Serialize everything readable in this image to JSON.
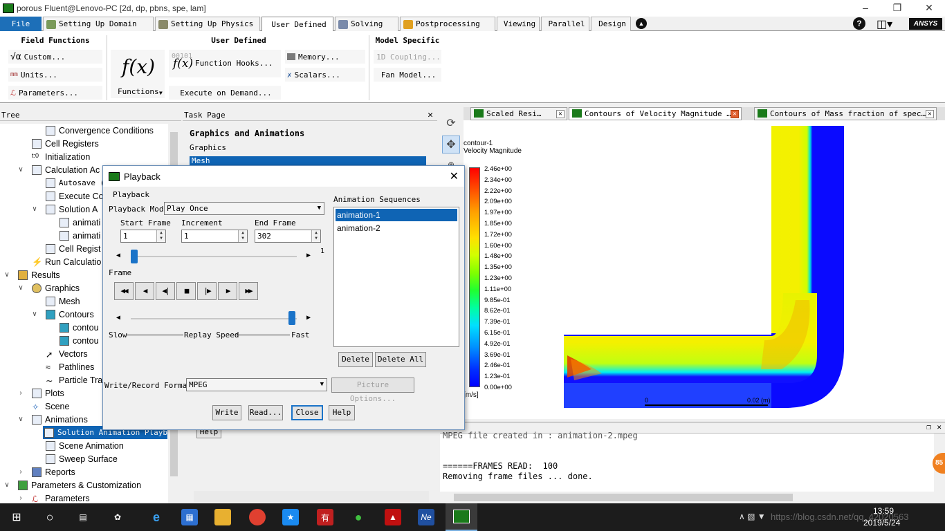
{
  "window": {
    "title": "porous Fluent@Lenovo-PC  [2d, dp, pbns, spe, lam]"
  },
  "tabs": [
    {
      "label": "File"
    },
    {
      "label": "Setting Up Domain"
    },
    {
      "label": "Setting Up Physics"
    },
    {
      "label": "User Defined"
    },
    {
      "label": "Solving"
    },
    {
      "label": "Postprocessing"
    },
    {
      "label": "Viewing"
    },
    {
      "label": "Parallel"
    },
    {
      "label": "Design"
    }
  ],
  "brand": "ANSYS",
  "ribbon": {
    "field_functions": {
      "title": "Field Functions",
      "custom": "Custom...",
      "units": "Units...",
      "parameters": "Parameters..."
    },
    "user_defined": {
      "title": "User Defined",
      "functions": "Functions",
      "function_hooks": "Function Hooks...",
      "execute_on_demand": "Execute on Demand...",
      "memory": "Memory...",
      "scalars": "Scalars...",
      "hooks_bits": "00101"
    },
    "model_specific": {
      "title": "Model Specific",
      "coupling": "1D Coupling...",
      "fan_model": "Fan Model..."
    }
  },
  "tree": {
    "header": "Tree",
    "items": [
      {
        "label": "Convergence Conditions"
      },
      {
        "label": "Cell Registers"
      },
      {
        "label": "Initialization"
      },
      {
        "label": "Calculation Ac"
      },
      {
        "label": "Autosave (Every 1 iter"
      },
      {
        "label": "Execute Co"
      },
      {
        "label": "Solution A"
      },
      {
        "label": "animati"
      },
      {
        "label": "animati"
      },
      {
        "label": "Cell Regist"
      },
      {
        "label": "Run Calculatio"
      },
      {
        "label": "Results"
      },
      {
        "label": "Graphics"
      },
      {
        "label": "Mesh"
      },
      {
        "label": "Contours"
      },
      {
        "label": "contou"
      },
      {
        "label": "contou"
      },
      {
        "label": "Vectors"
      },
      {
        "label": "Pathlines"
      },
      {
        "label": "Particle Tra"
      },
      {
        "label": "Plots"
      },
      {
        "label": "Scene"
      },
      {
        "label": "Animations"
      },
      {
        "label": "Solution Animation Playback"
      },
      {
        "label": "Scene Animation"
      },
      {
        "label": "Sweep Surface"
      },
      {
        "label": "Reports"
      },
      {
        "label": "Parameters & Customization"
      },
      {
        "label": "Parameters"
      }
    ]
  },
  "task_page": {
    "header": "Task Page",
    "section": "Graphics and Animations",
    "graphics_label": "Graphics",
    "mesh_item": "Mesh",
    "help": "Help"
  },
  "graphics_tabs": [
    {
      "label": "Scaled Resi…"
    },
    {
      "label": "Contours of Velocity Magnitude …"
    },
    {
      "label": "Contours of Mass fraction of spec…"
    }
  ],
  "contour": {
    "title": "contour-1",
    "subtitle": "Velocity Magnitude",
    "unit": "[m/s]",
    "legend_values": [
      "2.46e+00",
      "2.34e+00",
      "2.22e+00",
      "2.09e+00",
      "1.97e+00",
      "1.85e+00",
      "1.72e+00",
      "1.60e+00",
      "1.48e+00",
      "1.35e+00",
      "1.23e+00",
      "1.11e+00",
      "9.85e-01",
      "8.62e-01",
      "7.39e-01",
      "6.15e-01",
      "4.92e-01",
      "3.69e-01",
      "2.46e-01",
      "1.23e-01",
      "0.00e+00"
    ],
    "scale_start": "0",
    "scale_end": "0.02 (m)"
  },
  "console": {
    "header": "e",
    "lines": [
      "MPEG file created in : animation-2.mpeg",
      "",
      "======FRAMES READ:  100",
      "Removing frame files ... done."
    ]
  },
  "dialog": {
    "title": "Playback",
    "group": "Playback",
    "mode_label": "Playback Mode",
    "mode_value": "Play Once",
    "start_label": "Start Frame",
    "start_value": "1",
    "increment_label": "Increment",
    "increment_value": "1",
    "end_label": "End Frame",
    "end_value": "302",
    "slider_value": "1",
    "frame_label": "Frame",
    "slow": "Slow",
    "replay_speed": "Replay Speed",
    "fast": "Fast",
    "format_label": "Write/Record Format",
    "format_value": "MPEG",
    "picture_options": "Picture Options...",
    "seq_label": "Animation Sequences",
    "sequences": [
      "animation-1",
      "animation-2"
    ],
    "delete": "Delete",
    "delete_all": "Delete All",
    "write": "Write",
    "read": "Read...",
    "close": "Close",
    "help": "Help"
  },
  "taskbar": {
    "time": "13:59",
    "date": "2019/5/24",
    "watermark": "https://blog.csdn.net/qq_42020563",
    "badge": "85"
  },
  "colors": {
    "accent": "#1a73c8",
    "file_tab": "#1d6fb8",
    "selected": "#0f64b4"
  }
}
